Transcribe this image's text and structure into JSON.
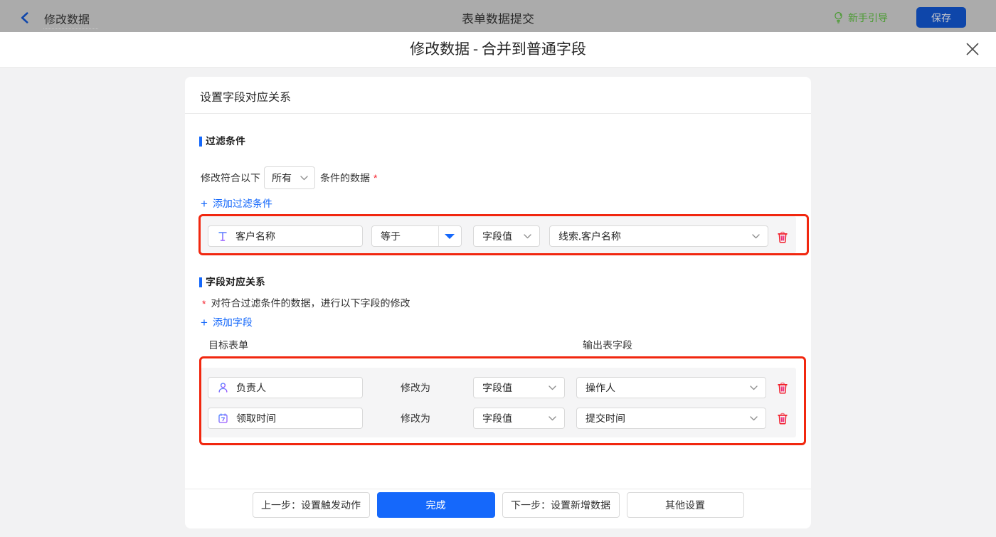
{
  "topbar": {
    "back_label": "修改数据",
    "page_title": "表单数据提交",
    "guide_label": "新手引导",
    "save_label": "保存"
  },
  "dialog": {
    "title": "修改数据 - 合并到普通字段"
  },
  "panel": {
    "title": "设置字段对应关系"
  },
  "filter_section": {
    "heading": "过滤条件",
    "criteria_prefix": "修改符合以下",
    "match_mode": "所有",
    "criteria_suffix": "条件的数据",
    "required_mark": "*",
    "add_plus": "+",
    "add_label": "添加过滤条件",
    "condition": {
      "field": "客户名称",
      "operator": "等于",
      "value_type": "字段值",
      "value": "线索.客户名称"
    }
  },
  "mapping_section": {
    "heading": "字段对应关系",
    "required_mark": "*",
    "description": "对符合过滤条件的数据，进行以下字段的修改",
    "add_plus": "+",
    "add_label": "添加字段",
    "col_target": "目标表单",
    "col_output": "输出表字段",
    "action_label": "修改为",
    "rows": [
      {
        "field": "负责人",
        "action": "修改为",
        "value_type": "字段值",
        "value": "操作人",
        "icon": "user-icon"
      },
      {
        "field": "领取时间",
        "action": "修改为",
        "value_type": "字段值",
        "value": "提交时间",
        "icon": "calendar-icon"
      }
    ]
  },
  "footer": {
    "prev_label": "上一步：设置触发动作",
    "done_label": "完成",
    "next_label": "下一步：设置新增数据",
    "other_label": "其他设置"
  },
  "colors": {
    "accent_blue": "#1568fb",
    "highlight_red": "#f1270f",
    "danger_red": "#f4333f",
    "guide_green": "#4a9b31",
    "topbar_dimmed": "#ababab"
  }
}
